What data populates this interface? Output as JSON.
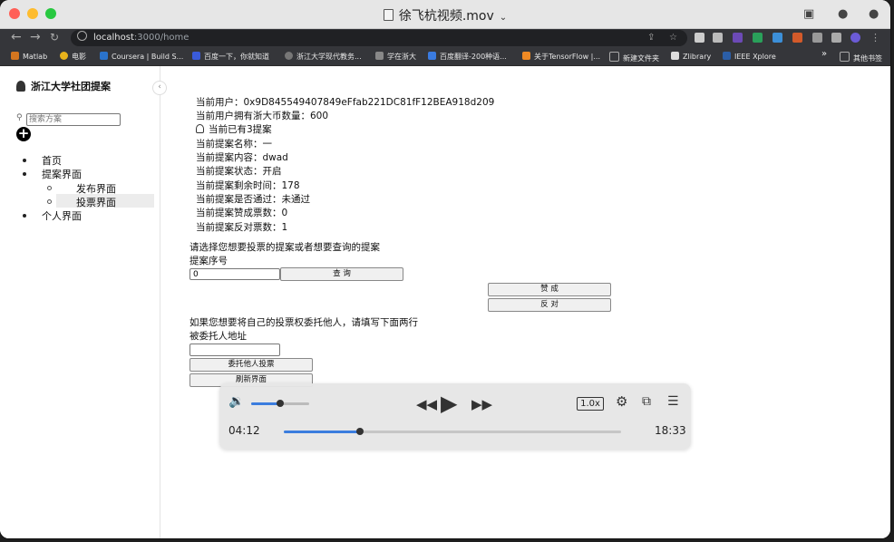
{
  "window": {
    "title": "徐飞杭视频.mov"
  },
  "browser": {
    "url_host": "localhost",
    "url_path": ":3000/home",
    "bookmarks": [
      {
        "label": "Matlab",
        "color": "#d4761f"
      },
      {
        "label": "电影",
        "color": "#e8b21b"
      },
      {
        "label": "Coursera | Build S...",
        "color": "#2a73cc"
      },
      {
        "label": "百度一下，你就知道",
        "color": "#3a5bd9"
      },
      {
        "label": "浙江大学现代教务...",
        "color": "#777777"
      },
      {
        "label": "学在浙大",
        "color": "#888888"
      },
      {
        "label": "百度翻译-200种语...",
        "color": "#3a7be0"
      },
      {
        "label": "关于TensorFlow |...",
        "color": "#f08a24"
      },
      {
        "label": "新建文件夹",
        "color": "#aaaaaa"
      },
      {
        "label": "Zlibrary",
        "color": "#dddddd"
      },
      {
        "label": "IEEE Xplore",
        "color": "#2b5ea7"
      }
    ],
    "overflow_label": "»",
    "other_bookmarks": "其他书签"
  },
  "sidebar": {
    "brand": "浙江大学社团提案",
    "search_placeholder": "搜索方案",
    "add_symbol": "+",
    "menu": [
      {
        "label": "首页"
      },
      {
        "label": "提案界面"
      },
      {
        "label": "发布界面"
      },
      {
        "label": "投票界面"
      },
      {
        "label": "个人界面"
      }
    ]
  },
  "main": {
    "current_user": "当前用户：0x9D845549407849eFfab221DC81fF12BEA918d209",
    "coin_count": "当前用户拥有浙大币数量：600",
    "proposal_count": "当前已有3提案",
    "proposal_name": "当前提案名称：一",
    "proposal_content": "当前提案内容：dwad",
    "proposal_status": "当前提案状态：开启",
    "remaining_time": "当前提案剩余时间：178",
    "passed": "当前提案是否通过：未通过",
    "approve_votes": "当前提案赞成票数：0",
    "oppose_votes": "当前提案反对票数：1",
    "select_prompt": "请选择您想要投票的提案或者想要查询的提案",
    "proposal_index_label": "提案序号",
    "proposal_index_value": "0",
    "query_button": "查 询",
    "approve_button": "赞 成",
    "oppose_button": "反 对",
    "delegate_prompt": "如果您想要将自己的投票权委托他人，请填写下面两行",
    "delegate_address_label": "被委托人地址",
    "delegate_address_value": "",
    "delegate_button": "委托他人投票",
    "refresh_button": "刷新界面"
  },
  "player": {
    "current_time": "04:12",
    "total_time": "18:33",
    "speed": "1.0x",
    "volume": 0.5,
    "progress": 0.227,
    "accent": "#3b7dde"
  }
}
